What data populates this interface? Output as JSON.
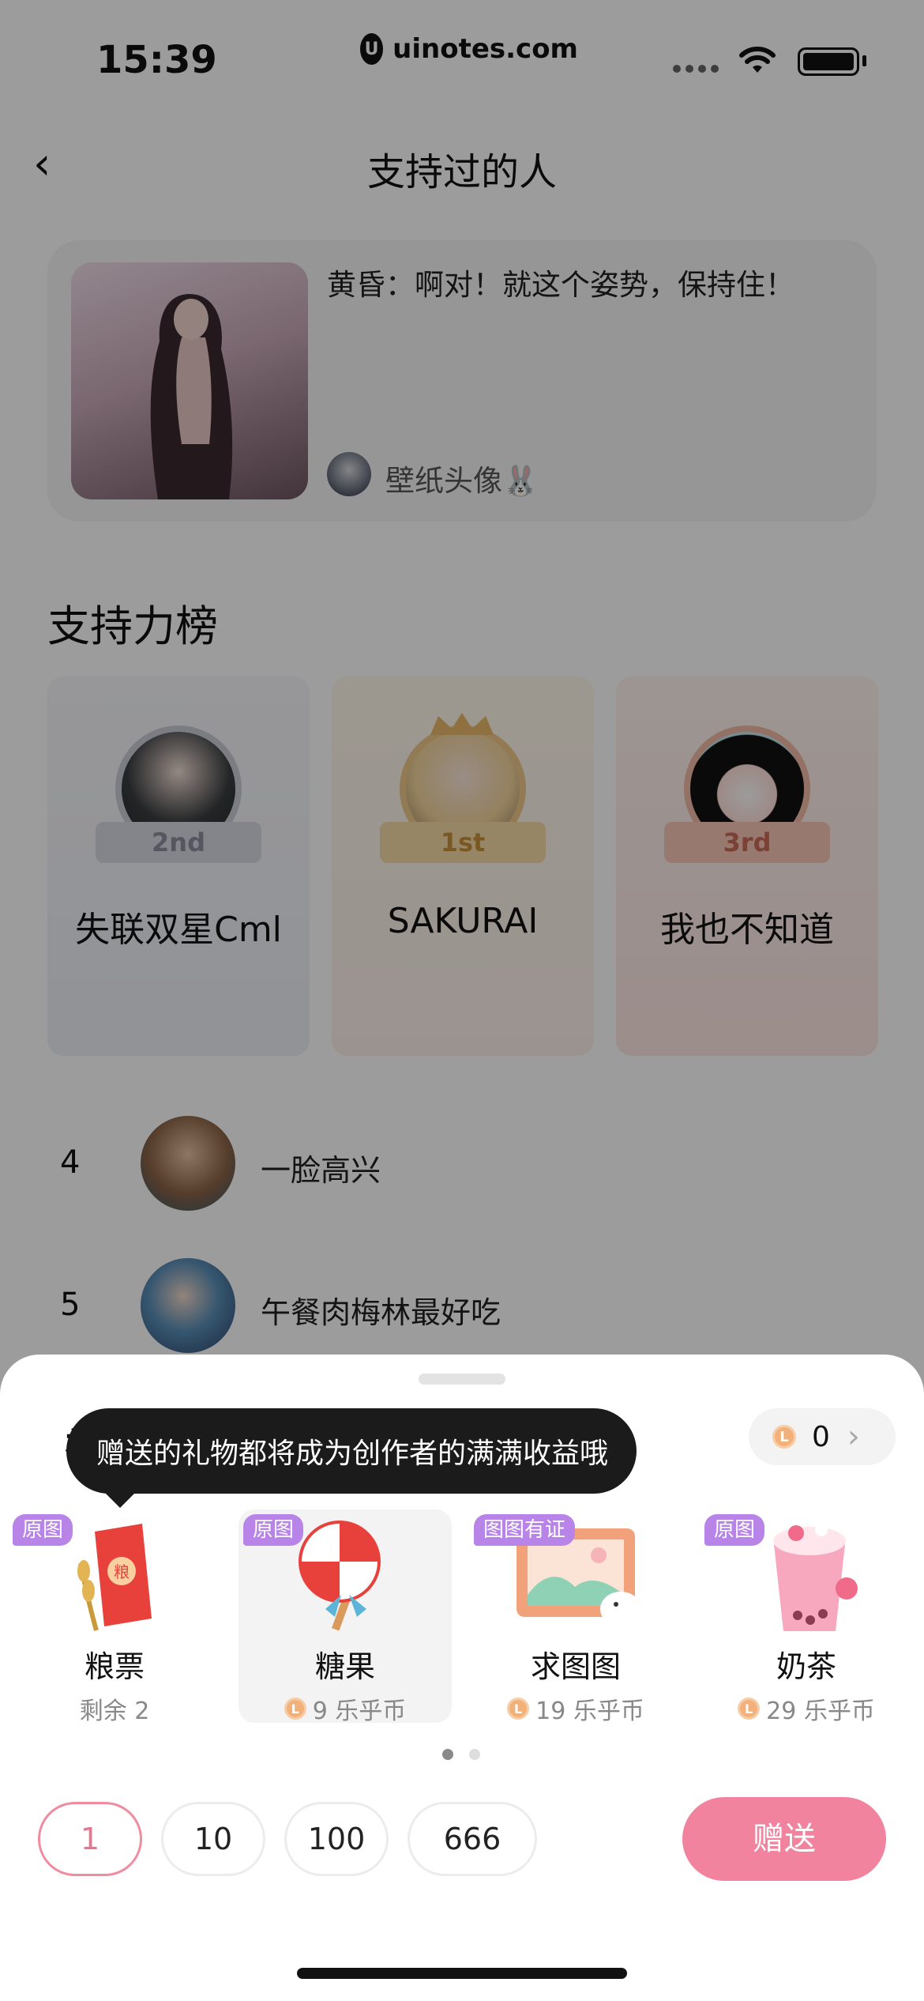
{
  "status_bar": {
    "time": "15:39",
    "url": "uinotes.com",
    "url_logo": "U"
  },
  "header": {
    "back_icon": "‹",
    "title": "支持过的人"
  },
  "featured": {
    "description": "黄昏：啊对！就这个姿势，保持住！",
    "author": "壁纸头像🐰"
  },
  "ranking": {
    "title": "支持力榜",
    "podium": [
      {
        "badge": "2nd",
        "name": "失联双星Cml"
      },
      {
        "badge": "1st",
        "name": "SAKURAI"
      },
      {
        "badge": "3rd",
        "name": "我也不知道"
      }
    ],
    "list": [
      {
        "rank": "4",
        "name": "一脸高兴"
      },
      {
        "rank": "5",
        "name": "午餐肉梅林最好吃"
      }
    ]
  },
  "gift_sheet": {
    "title": "礼物",
    "tooltip": "赠送的礼物都将成为创作者的满满收益哦",
    "balance": "0",
    "balance_chevron": "›",
    "coin_symbol": "L",
    "gifts": [
      {
        "badge": "原图",
        "name": "粮票",
        "sub": "剩余 2"
      },
      {
        "badge": "原图",
        "name": "糖果",
        "price": "9 乐乎币"
      },
      {
        "badge": "图图有证",
        "name": "求图图",
        "price": "19 乐乎币"
      },
      {
        "badge": "原图",
        "name": "奶茶",
        "price": "29 乐乎币"
      }
    ],
    "quantities": [
      "1",
      "10",
      "100",
      "666"
    ],
    "send_label": "赠送"
  },
  "colors": {
    "accent": "#f1839e",
    "badge_purple": "#b884e8",
    "overlay": "rgba(0,0,0,0.39)"
  }
}
